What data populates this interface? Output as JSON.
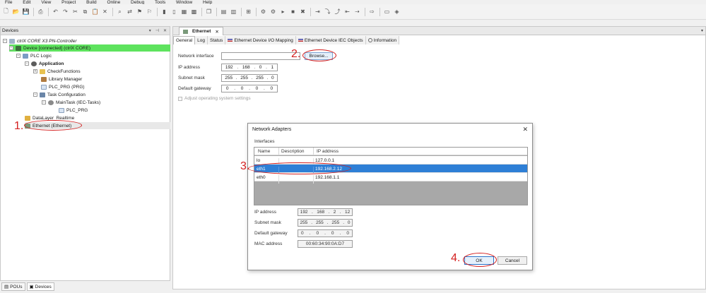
{
  "menu": [
    "File",
    "Edit",
    "View",
    "Project",
    "Build",
    "Online",
    "Debug",
    "Tools",
    "Window",
    "Help"
  ],
  "devices_panel": {
    "title": "Devices",
    "pin_icon": "pin-icon",
    "close_icon": "close-icon",
    "tree": [
      {
        "label": "ctrlX CORE X3 PN-Controller",
        "indent": 0
      },
      {
        "label": "Device [connected] (ctrlX CORE)",
        "indent": 1
      },
      {
        "label": "PLC Logic",
        "indent": 2
      },
      {
        "label": "Application",
        "indent": 3
      },
      {
        "label": "CheckFunctions",
        "indent": 4
      },
      {
        "label": "Library Manager",
        "indent": 4
      },
      {
        "label": "PLC_PRG (PRG)",
        "indent": 4
      },
      {
        "label": "Task Configuration",
        "indent": 4
      },
      {
        "label": "MainTask (IEC-Tasks)",
        "indent": 5
      },
      {
        "label": "PLC_PRG",
        "indent": 6
      },
      {
        "label": "DataLayer_Realtime",
        "indent": 2
      },
      {
        "label": "Ethernet (Ethernet)",
        "indent": 2
      }
    ],
    "bottom_tabs": [
      "POUs",
      "Devices"
    ]
  },
  "editor": {
    "doc_tab": "Ethernet",
    "sub_tabs": [
      "General",
      "Log",
      "Status",
      "Ethernet Device I/O Mapping",
      "Ethernet Device IEC Objects",
      "Information"
    ],
    "network_interface_label": "Network interface",
    "browse_label": "Browse...",
    "ip_label": "IP address",
    "ip": [
      "192",
      "168",
      "0",
      "1"
    ],
    "subnet_label": "Subnet mask",
    "subnet": [
      "255",
      "255",
      "255",
      "0"
    ],
    "gateway_label": "Default gateway",
    "gateway": [
      "0",
      "0",
      "0",
      "0"
    ],
    "adjust_label": "Adjust operating system settings"
  },
  "dialog": {
    "title": "Network Adapters",
    "interfaces_label": "Interfaces",
    "columns": [
      "Name",
      "Description",
      "IP address"
    ],
    "rows": [
      {
        "name": "lo",
        "description": "",
        "ip": "127.0.0.1"
      },
      {
        "name": "eth1",
        "description": "",
        "ip": "192.168.2.12"
      },
      {
        "name": "eth0",
        "description": "",
        "ip": "192.168.1.1"
      }
    ],
    "ip_label": "IP address",
    "ip": [
      "192",
      "168",
      "2",
      "12"
    ],
    "subnet_label": "Subnet mask",
    "subnet": [
      "255",
      "255",
      "255",
      "0"
    ],
    "gateway_label": "Default gateway",
    "gateway": [
      "0",
      "0",
      "0",
      "0"
    ],
    "mac_label": "MAC address",
    "mac": "00:60:34:90:0A:D7",
    "ok_label": "OK",
    "cancel_label": "Cancel"
  },
  "annotations": [
    "1.",
    "2.",
    "3.",
    "4."
  ],
  "colors": {
    "connected_row": "#5ee35e",
    "selected_row": "#2e7fd6",
    "annotation": "#d42020"
  }
}
